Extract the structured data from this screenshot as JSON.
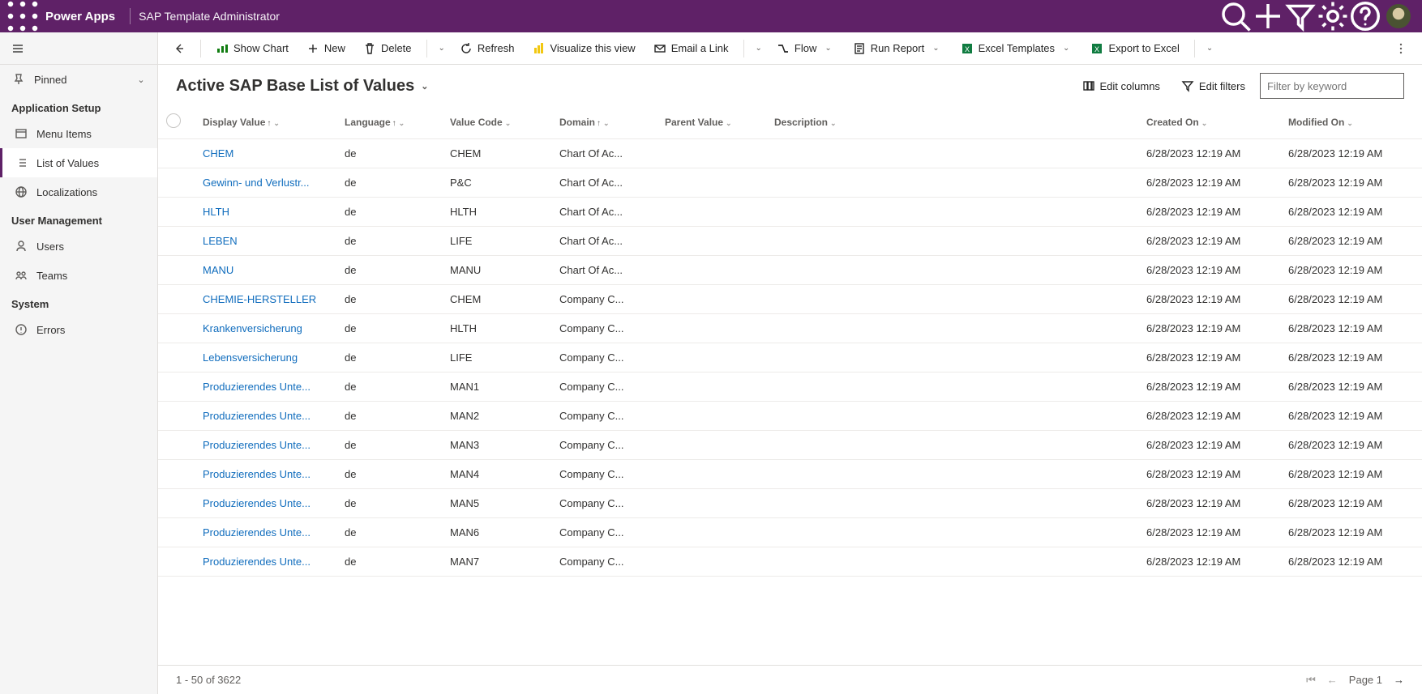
{
  "header": {
    "brand": "Power Apps",
    "env": "SAP Template Administrator"
  },
  "nav": {
    "pinned": "Pinned",
    "section_app": "Application Setup",
    "section_user": "User Management",
    "section_sys": "System",
    "items": {
      "menu_items": "Menu Items",
      "list_of_values": "List of Values",
      "localizations": "Localizations",
      "users": "Users",
      "teams": "Teams",
      "errors": "Errors"
    }
  },
  "cmd": {
    "show_chart": "Show Chart",
    "new": "New",
    "delete": "Delete",
    "refresh": "Refresh",
    "visualize": "Visualize this view",
    "email": "Email a Link",
    "flow": "Flow",
    "run_report": "Run Report",
    "excel_tmpl": "Excel Templates",
    "export_excel": "Export to Excel"
  },
  "view": {
    "title": "Active SAP Base List of Values",
    "edit_columns": "Edit columns",
    "edit_filters": "Edit filters",
    "filter_placeholder": "Filter by keyword"
  },
  "columns": {
    "display": "Display Value",
    "language": "Language",
    "code": "Value Code",
    "domain": "Domain",
    "parent": "Parent Value",
    "description": "Description",
    "created": "Created On",
    "modified": "Modified On"
  },
  "rows": [
    {
      "display": "CHEM",
      "lang": "de",
      "code": "CHEM",
      "domain": "Chart Of Ac...",
      "created": "6/28/2023 12:19 AM",
      "modified": "6/28/2023 12:19 AM"
    },
    {
      "display": "Gewinn- und Verlustr...",
      "lang": "de",
      "code": "P&C",
      "domain": "Chart Of Ac...",
      "created": "6/28/2023 12:19 AM",
      "modified": "6/28/2023 12:19 AM"
    },
    {
      "display": "HLTH",
      "lang": "de",
      "code": "HLTH",
      "domain": "Chart Of Ac...",
      "created": "6/28/2023 12:19 AM",
      "modified": "6/28/2023 12:19 AM"
    },
    {
      "display": "LEBEN",
      "lang": "de",
      "code": "LIFE",
      "domain": "Chart Of Ac...",
      "created": "6/28/2023 12:19 AM",
      "modified": "6/28/2023 12:19 AM"
    },
    {
      "display": "MANU",
      "lang": "de",
      "code": "MANU",
      "domain": "Chart Of Ac...",
      "created": "6/28/2023 12:19 AM",
      "modified": "6/28/2023 12:19 AM"
    },
    {
      "display": "CHEMIE-HERSTELLER",
      "lang": "de",
      "code": "CHEM",
      "domain": "Company C...",
      "created": "6/28/2023 12:19 AM",
      "modified": "6/28/2023 12:19 AM"
    },
    {
      "display": "Krankenversicherung",
      "lang": "de",
      "code": "HLTH",
      "domain": "Company C...",
      "created": "6/28/2023 12:19 AM",
      "modified": "6/28/2023 12:19 AM"
    },
    {
      "display": "Lebensversicherung",
      "lang": "de",
      "code": "LIFE",
      "domain": "Company C...",
      "created": "6/28/2023 12:19 AM",
      "modified": "6/28/2023 12:19 AM"
    },
    {
      "display": "Produzierendes Unte...",
      "lang": "de",
      "code": "MAN1",
      "domain": "Company C...",
      "created": "6/28/2023 12:19 AM",
      "modified": "6/28/2023 12:19 AM"
    },
    {
      "display": "Produzierendes Unte...",
      "lang": "de",
      "code": "MAN2",
      "domain": "Company C...",
      "created": "6/28/2023 12:19 AM",
      "modified": "6/28/2023 12:19 AM"
    },
    {
      "display": "Produzierendes Unte...",
      "lang": "de",
      "code": "MAN3",
      "domain": "Company C...",
      "created": "6/28/2023 12:19 AM",
      "modified": "6/28/2023 12:19 AM"
    },
    {
      "display": "Produzierendes Unte...",
      "lang": "de",
      "code": "MAN4",
      "domain": "Company C...",
      "created": "6/28/2023 12:19 AM",
      "modified": "6/28/2023 12:19 AM"
    },
    {
      "display": "Produzierendes Unte...",
      "lang": "de",
      "code": "MAN5",
      "domain": "Company C...",
      "created": "6/28/2023 12:19 AM",
      "modified": "6/28/2023 12:19 AM"
    },
    {
      "display": "Produzierendes Unte...",
      "lang": "de",
      "code": "MAN6",
      "domain": "Company C...",
      "created": "6/28/2023 12:19 AM",
      "modified": "6/28/2023 12:19 AM"
    },
    {
      "display": "Produzierendes Unte...",
      "lang": "de",
      "code": "MAN7",
      "domain": "Company C...",
      "created": "6/28/2023 12:19 AM",
      "modified": "6/28/2023 12:19 AM"
    }
  ],
  "footer": {
    "count": "1 - 50 of 3622",
    "page": "Page 1"
  }
}
